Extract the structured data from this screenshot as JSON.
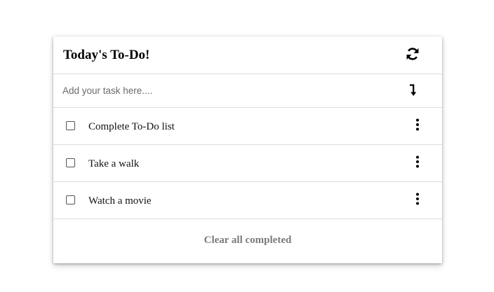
{
  "header": {
    "title": "Today's To-Do!",
    "refresh_icon": "refresh-icon"
  },
  "new_task": {
    "placeholder": "Add your task here....",
    "value": "",
    "enter_icon": "arrow-down-enter-icon"
  },
  "tasks": [
    {
      "label": "Complete To-Do list",
      "checked": false,
      "menu_icon": "kebab-menu-icon"
    },
    {
      "label": "Take a walk",
      "checked": false,
      "menu_icon": "kebab-menu-icon"
    },
    {
      "label": "Watch a movie",
      "checked": false,
      "menu_icon": "kebab-menu-icon"
    }
  ],
  "footer": {
    "clear_label": "Clear all completed"
  },
  "colors": {
    "divider": "#dddddd",
    "clear_text": "#7a7a7a",
    "text": "#111111"
  }
}
